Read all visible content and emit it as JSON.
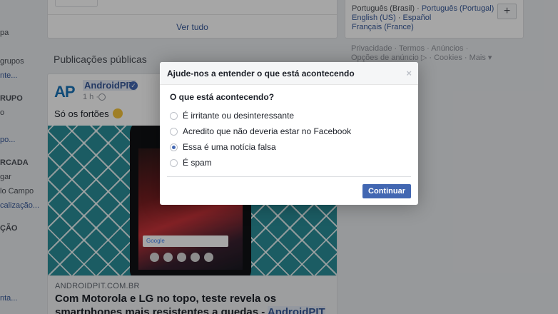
{
  "left_nav": {
    "items": [
      {
        "text": "pa",
        "kind": "plain"
      },
      {
        "text": "grupos",
        "kind": "plain"
      },
      {
        "text": "nte...",
        "kind": "link"
      },
      {
        "text": "RUPO",
        "kind": "head"
      },
      {
        "text": "o",
        "kind": "plain"
      },
      {
        "text": "po...",
        "kind": "link"
      },
      {
        "text": "RCADA",
        "kind": "head"
      },
      {
        "text": "gar",
        "kind": "plain"
      },
      {
        "text": "lo Campo",
        "kind": "plain"
      },
      {
        "text": "calização...",
        "kind": "link"
      },
      {
        "text": "ÇÃO",
        "kind": "head"
      },
      {
        "text": "nta...",
        "kind": "link"
      }
    ]
  },
  "top_card": {
    "see_all": "Ver tudo"
  },
  "section_title": "Publicações públicas",
  "post": {
    "avatar_text": "AP",
    "page_name": "AndroidPIT",
    "time": "1 h ·",
    "text": "Só os fortões",
    "photo_search_label": "Google",
    "link_domain": "ANDROIDPIT.COM.BR",
    "link_title_part1": "Com Motorola e LG no topo, teste revela os smartphones mais resistentes a quedas - ",
    "link_title_hl": "AndroidPIT"
  },
  "right_card": {
    "lang1": "Português (Brasil)",
    "lang2": "Português (Portugal)",
    "lang3": "English (US)",
    "lang4": "Español",
    "lang5": "Français (France)",
    "add_label": "+"
  },
  "footer_links": "Privacidade · Termos · Anúncios · Opções de anúncio ▷ · Cookies · Mais ▾",
  "dialog": {
    "title": "Ajude-nos a entender o que está acontecendo",
    "close": "×",
    "question": "O que está acontecendo?",
    "options": [
      {
        "label": "É irritante ou desinteressante",
        "checked": false
      },
      {
        "label": "Acredito que não deveria estar no Facebook",
        "checked": false
      },
      {
        "label": "Essa é uma notícia falsa",
        "checked": true
      },
      {
        "label": "É spam",
        "checked": false
      }
    ],
    "continue_label": "Continuar"
  },
  "colors": {
    "accent": "#4267b2",
    "link": "#365899",
    "background": "#e9ebee"
  }
}
